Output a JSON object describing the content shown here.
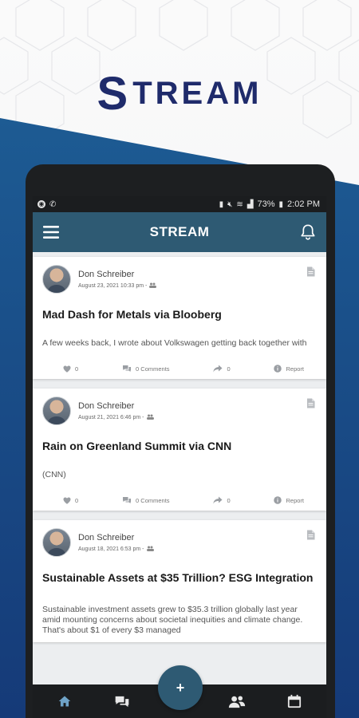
{
  "brand": {
    "s": "S",
    "rest": "TREAM"
  },
  "status_bar": {
    "battery": "73%",
    "time": "2:02 PM"
  },
  "app_bar": {
    "title": "STREAM"
  },
  "posts": [
    {
      "author": "Don Schreiber",
      "date": "August 23, 2021 10:33 pm -",
      "title": "Mad Dash for Metals via Blooberg",
      "excerpt": "A few weeks back, I wrote about Volkswagen getting back together with",
      "likes": "0",
      "comments": "0 Comments",
      "shares": "0",
      "report": "Report"
    },
    {
      "author": "Don Schreiber",
      "date": "August 21, 2021 6:46 pm -",
      "title": "Rain on Greenland Summit via CNN",
      "excerpt": "(CNN)",
      "likes": "0",
      "comments": "0 Comments",
      "shares": "0",
      "report": "Report"
    },
    {
      "author": "Don Schreiber",
      "date": "August 18, 2021 6:53 pm -",
      "title": "Sustainable Assets at $35 Trillion? ESG Integration",
      "excerpt": "Sustainable investment assets grew to $35.3 trillion globally last year amid mounting concerns about societal inequities and climate change. That's about $1 of every $3 managed"
    }
  ],
  "fab": {
    "label": "+"
  },
  "colors": {
    "brand": "#1f2b6b",
    "app_bar": "#2e5a73",
    "nav_bar": "#1b1d1f",
    "nav_active": "#6fa3c7"
  },
  "icons": {
    "status_left": [
      "app-icon",
      "call-icon"
    ],
    "status_right": [
      "sim-icon",
      "mute-icon",
      "wifi-icon",
      "signal-icon",
      "battery-icon"
    ],
    "bottom_nav": [
      "home-icon",
      "chat-icon",
      "people-icon",
      "calendar-icon"
    ]
  }
}
